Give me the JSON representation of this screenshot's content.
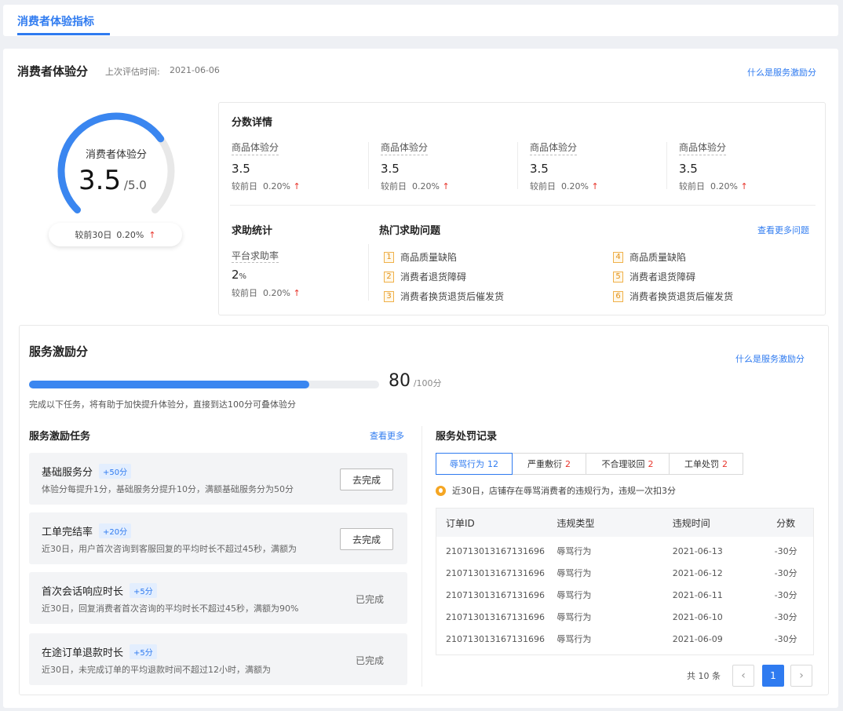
{
  "topbar": {
    "tab_label": "消费者体验指标"
  },
  "header": {
    "title": "消费者体验分",
    "eval_time_label": "上次评估时间:",
    "eval_time": "2021-06-06",
    "help_link": "什么是服务激励分"
  },
  "gauge": {
    "label": "消费者体验分",
    "value": "3.5",
    "max": "/5.0",
    "fraction": 0.7,
    "compare_label": "较前30日",
    "compare_value": "0.20%",
    "trend": "↑",
    "colors": {
      "arc": "#3a86f0",
      "track": "#e8e8e8"
    }
  },
  "score_detail": {
    "title": "分数详情",
    "metrics": [
      {
        "name": "商品体验分",
        "value": "3.5",
        "compare_label": "较前日",
        "compare_value": "0.20%",
        "trend": "↑"
      },
      {
        "name": "商品体验分",
        "value": "3.5",
        "compare_label": "较前日",
        "compare_value": "0.20%",
        "trend": "↑"
      },
      {
        "name": "商品体验分",
        "value": "3.5",
        "compare_label": "较前日",
        "compare_value": "0.20%",
        "trend": "↑"
      },
      {
        "name": "商品体验分",
        "value": "3.5",
        "compare_label": "较前日",
        "compare_value": "0.20%",
        "trend": "↑"
      }
    ]
  },
  "help_stats": {
    "title": "求助统计",
    "rate_label": "平台求助率",
    "rate_value": "2",
    "rate_unit": "%",
    "compare_label": "较前日",
    "compare_value": "0.20%",
    "trend": "↑"
  },
  "hot_questions": {
    "title": "热门求助问题",
    "more_link": "查看更多问题",
    "items": [
      {
        "rank": "1",
        "text": "商品质量缺陷"
      },
      {
        "rank": "2",
        "text": "消费者退货障碍"
      },
      {
        "rank": "3",
        "text": "消费者换货退货后催发货"
      },
      {
        "rank": "4",
        "text": "商品质量缺陷"
      },
      {
        "rank": "5",
        "text": "消费者退货障碍"
      },
      {
        "rank": "6",
        "text": "消费者换货退货后催发货"
      }
    ]
  },
  "incentive": {
    "title": "服务激励分",
    "help_link": "什么是服务激励分",
    "progress_value": "80",
    "progress_max": "/100分",
    "progress_fraction": 0.8,
    "hint": "完成以下任务，将有助于加快提升体验分，直接到达100分可叠体验分",
    "tasks_title": "服务激励任务",
    "tasks_more": "查看更多",
    "tasks": [
      {
        "title": "基础服务分",
        "badge": "+50分",
        "desc": "体验分每提升1分，基础服务分提升10分，满额基础服务分为50分",
        "action": "去完成",
        "done": false
      },
      {
        "title": "工单完结率",
        "badge": "+20分",
        "desc": "近30日，用户首次咨询到客服回复的平均时长不超过45秒，满额为",
        "action": "去完成",
        "done": false
      },
      {
        "title": "首次会话响应时长",
        "badge": "+5分",
        "desc": "近30日，回复消费者首次咨询的平均时长不超过45秒，满额为90%",
        "action": "已完成",
        "done": true
      },
      {
        "title": "在途订单退款时长",
        "badge": "+5分",
        "desc": "近30日，未完成订单的平均退款时间不超过12小时，满额为",
        "action": "已完成",
        "done": true
      }
    ]
  },
  "penalty": {
    "title": "服务处罚记录",
    "tabs": [
      {
        "label": "辱骂行为",
        "count": "12",
        "active": true
      },
      {
        "label": "严重敷衍",
        "count": "2",
        "active": false
      },
      {
        "label": "不合理驳回",
        "count": "2",
        "active": false
      },
      {
        "label": "工单处罚",
        "count": "2",
        "active": false
      }
    ],
    "notice": "近30日，店铺存在辱骂消费者的违规行为，违规一次扣3分",
    "columns": [
      "订单ID",
      "违规类型",
      "违规时间",
      "分数"
    ],
    "rows": [
      [
        "21071301316713​1696",
        "辱骂行为",
        "2021-06-13",
        "-30分"
      ],
      [
        "210713013167131696",
        "辱骂行为",
        "2021-06-12",
        "-30分"
      ],
      [
        "210713013167131696",
        "辱骂行为",
        "2021-06-11",
        "-30分"
      ],
      [
        "210713013167131696",
        "辱骂行为",
        "2021-06-10",
        "-30分"
      ],
      [
        "210713013167131696",
        "辱骂行为",
        "2021-06-09",
        "-30分"
      ]
    ],
    "pager": {
      "total": "共 10 条",
      "prev": "‹",
      "page": "1",
      "next": "›"
    }
  }
}
